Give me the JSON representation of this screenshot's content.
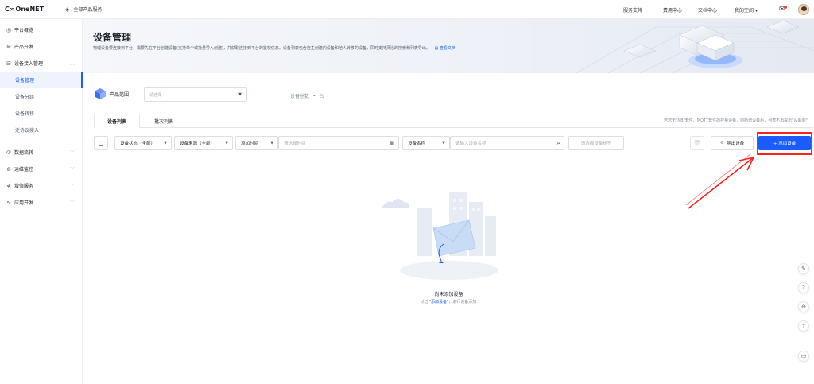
{
  "topbar": {
    "logo_mark": "C∞",
    "logo_text": "OneNET",
    "all_services": "全部产品服务",
    "nav": [
      "服务支持",
      "费用中心",
      "文档中心",
      "我的空间"
    ],
    "user_caret": "▾"
  },
  "sidebar": {
    "items": [
      {
        "label": "平台概览",
        "icon": "dashboard-icon"
      },
      {
        "label": "产品开发",
        "icon": "product-icon"
      },
      {
        "label": "设备接入管理",
        "icon": "device-access-icon"
      },
      {
        "label": "数据流转",
        "icon": "dataflow-icon"
      },
      {
        "label": "运维监控",
        "icon": "monitor-icon"
      },
      {
        "label": "增值服务",
        "icon": "value-added-icon"
      },
      {
        "label": "应用开发",
        "icon": "app-dev-icon"
      }
    ],
    "sub_items": [
      "设备管理",
      "设备分组",
      "设备转移",
      "泛协议接入"
    ],
    "active_sub": "设备管理"
  },
  "banner": {
    "title": "设备管理",
    "description": "物理设备要连接到平台，需要先在平台创建设备(支持单个或批量导入创建)，并获取连接到平台的鉴权信息。设备列表包含自主创建的设备和他人转移的设备，同时支持灵活的搜索和列表导出。",
    "doc_link": "查看文档"
  },
  "scope": {
    "label": "产品范围",
    "placeholder": "请选择",
    "total_label": "设备总数",
    "total_value": "-",
    "total_unit": "台"
  },
  "tabs": [
    {
      "label": "设备列表"
    },
    {
      "label": "批次列表"
    }
  ],
  "notice": "若您无\"NB\"套件、MQTT套件的存量设备，则新增设备后，列表不再提示\"设备ID\"",
  "filters": {
    "status": "设备状态（全部）",
    "source": "设备来源（全部）",
    "add_time": "添加时间",
    "time_placeholder": "请选择时间",
    "name_label": "设备名称",
    "name_placeholder": "请输入设备名称",
    "tag_placeholder": "请选择设备标签",
    "export": "导出设备",
    "add": "+ 添加设备"
  },
  "empty": {
    "title": "尚未添加设备",
    "sub_prefix": "点击",
    "sub_link": "\"添加设备\"",
    "sub_suffix": "，进行设备添加"
  },
  "colors": {
    "accent": "#1a5cff",
    "highlight": "#ff2020"
  }
}
